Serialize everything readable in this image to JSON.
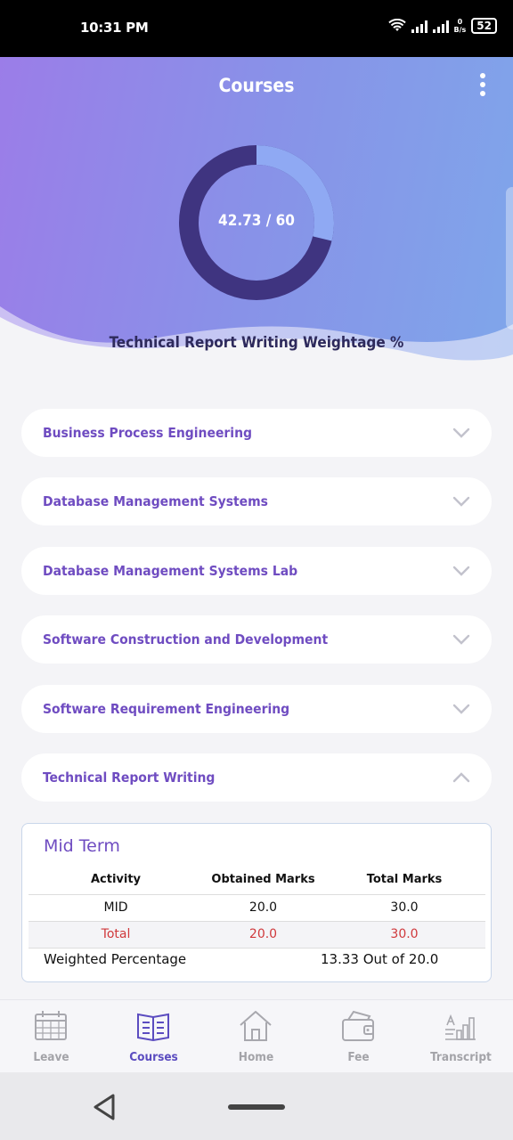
{
  "status_bar": {
    "time": "10:31 PM",
    "net_speed_value": "0",
    "net_speed_unit": "B/s",
    "battery": "52"
  },
  "header": {
    "title": "Courses",
    "donut_value": "42.73 / 60",
    "donut_fraction": 0.2878,
    "subtitle": "Technical Report Writing Weightage %"
  },
  "courses": [
    {
      "name": "Business Process Engineering",
      "expanded": false
    },
    {
      "name": "Database Management Systems",
      "expanded": false
    },
    {
      "name": "Database Management Systems Lab",
      "expanded": false
    },
    {
      "name": "Software Construction and Development",
      "expanded": false
    },
    {
      "name": "Software Requirement Engineering",
      "expanded": false
    },
    {
      "name": "Technical Report Writing",
      "expanded": true
    }
  ],
  "detail": {
    "section_title": "Mid Term",
    "columns": [
      "Activity",
      "Obtained Marks",
      "Total Marks"
    ],
    "rows": [
      {
        "activity": "MID",
        "obtained": "20.0",
        "total": "30.0"
      },
      {
        "activity": "Total",
        "obtained": "20.0",
        "total": "30.0"
      }
    ],
    "weighted_label": "Weighted Percentage",
    "weighted_value": "13.33 Out of 20.0"
  },
  "bottom_nav": [
    {
      "label": "Leave",
      "icon": "calendar-icon",
      "active": false
    },
    {
      "label": "Courses",
      "icon": "book-icon",
      "active": true
    },
    {
      "label": "Home",
      "icon": "home-icon",
      "active": false
    },
    {
      "label": "Fee",
      "icon": "wallet-icon",
      "active": false
    },
    {
      "label": "Transcript",
      "icon": "transcript-chart-icon",
      "active": false
    }
  ],
  "colors": {
    "accent": "#6f4cc1",
    "donut_dark": "#3f3480",
    "donut_light": "#8fa9f3",
    "total_red": "#d0393c",
    "nav_active": "#5b4cc0"
  }
}
